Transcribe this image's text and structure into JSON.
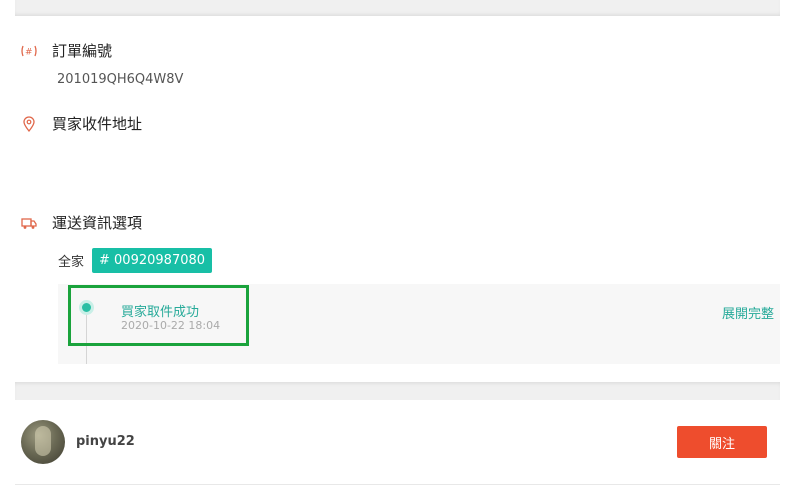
{
  "order": {
    "number_label": "訂單編號",
    "number_value": "201019QH6Q4W8V"
  },
  "address": {
    "label": "買家收件地址"
  },
  "shipping": {
    "label": "運送資訊選項",
    "carrier": "全家",
    "tracking_badge": "# 00920987080",
    "timeline": {
      "status": "買家取件成功",
      "time": "2020-10-22 18:04",
      "expand_label": "展開完整"
    }
  },
  "seller": {
    "name": "pinyu22",
    "follow_label": "關注"
  },
  "colors": {
    "accent": "#26aa99",
    "badge": "#18bfa6",
    "primary_button": "#ee4d2d",
    "icon": "#e0674a",
    "highlight_box": "#1aa33c"
  },
  "icons": {
    "order": "hash-icon",
    "address": "location-pin-icon",
    "shipping": "truck-icon"
  }
}
